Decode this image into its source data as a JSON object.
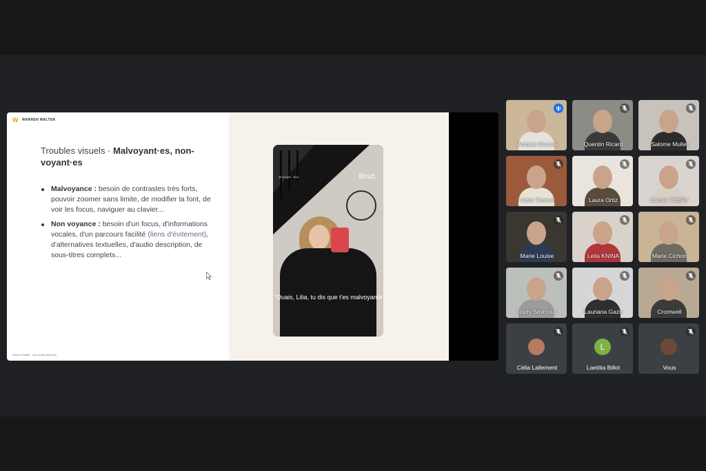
{
  "slide": {
    "logo_text": "WARREN WALTER",
    "title_plain": "Troubles visuels · ",
    "title_bold": "Malvoyant·es, non-voyant·es",
    "bullet1_bold": "Malvoyance :",
    "bullet1_text": " besoin de contrastes très forts, pouvoir zoomer sans limite, de modifier la font, de voir les focus, naviguer au clavier...",
    "bullet2_bold": "Non voyance :",
    "bullet2_text_a": " besoin d'un focus, d'informations vocales, d'un parcours facilité ",
    "bullet2_link": "(liens d'évitement)",
    "bullet2_text_b": ", d'alternatives textuelles, d'audio description, de sous-titres complets...",
    "footer": "Warren Walter - tous droits réservés",
    "video_brand": "Brut.",
    "video_caption": "\"Ouais, Lilia, tu dis que t'es malvoyante"
  },
  "participants": [
    {
      "name": "Antoine Boursa",
      "status": "speaking",
      "bg": "#cbb79a",
      "shirt": "#e6e2dc"
    },
    {
      "name": "Quentin Ricard",
      "status": "muted",
      "bg": "#8c8c86",
      "shirt": "#3a3a3a"
    },
    {
      "name": "Salome Mullet",
      "status": "muted",
      "bg": "#c7c2bb",
      "shirt": "#2c2c2c"
    },
    {
      "name": "victor Timmel",
      "status": "muted",
      "bg": "#9b5a3a",
      "shirt": "#e8e1d6"
    },
    {
      "name": "Laura Ortiz",
      "status": "muted",
      "bg": "#e9e5de",
      "shirt": "#5a4b3f"
    },
    {
      "name": "Carole THERY",
      "status": "muted",
      "bg": "#d9d4cf",
      "shirt": "#d8cfc4"
    },
    {
      "name": "Marie Louise",
      "status": "muted",
      "bg": "#3a3630",
      "shirt": "#2f3b52"
    },
    {
      "name": "Leila KNINA",
      "status": "muted",
      "bg": "#d9d2cb",
      "shirt": "#b2353a"
    },
    {
      "name": "Marie Cichon",
      "status": "muted",
      "bg": "#c9b496",
      "shirt": "#6f6a62"
    },
    {
      "name": "Rudy Seymour",
      "status": "muted",
      "bg": "#bcc0bd",
      "shirt": "#9b9b9b"
    },
    {
      "name": "Lauriana Gaze",
      "status": "muted",
      "bg": "#d6d6d6",
      "shirt": "#2f2f2f"
    },
    {
      "name": "Cromwell",
      "status": "muted",
      "bg": "#b9a892",
      "shirt": "#3b3b3b"
    },
    {
      "name": "Célia Lallement",
      "status": "muted",
      "avatar": "photo",
      "avatar_color": "#b57c62"
    },
    {
      "name": "Laetitia Billot",
      "status": "muted",
      "avatar": "letter",
      "avatar_letter": "L",
      "avatar_color": "#7cb342"
    },
    {
      "name": "Vous",
      "status": "muted",
      "avatar": "photo",
      "avatar_color": "#6b4a3a"
    }
  ]
}
